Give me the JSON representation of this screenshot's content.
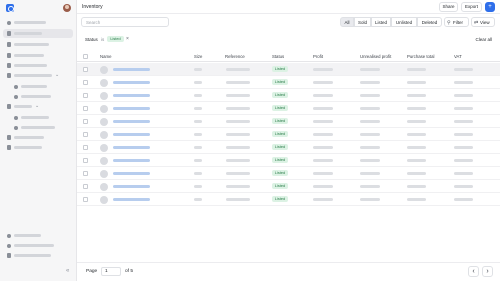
{
  "header": {
    "title": "Inventory",
    "share_label": "Share",
    "export_label": "Export",
    "add_label": "+"
  },
  "search": {
    "placeholder": "Search"
  },
  "status_tabs": [
    "All",
    "Sold",
    "Listed",
    "Unlisted",
    "Deleted"
  ],
  "active_tab": "All",
  "tools": {
    "filter_label": "Filter",
    "view_label": "View"
  },
  "active_filter": {
    "label": "Status",
    "operator": "is",
    "value": "Listed",
    "remove": "×",
    "clear_label": "Clear all"
  },
  "table": {
    "columns": [
      "Name",
      "Size",
      "Reference",
      "Status",
      "Profit",
      "Unrealised profit",
      "Purchase total",
      "VAT"
    ],
    "row_status": "Listed",
    "row_count": 11
  },
  "pagination": {
    "label": "Page",
    "current": "1",
    "of_label": "of 5",
    "prev": "‹",
    "next": "›"
  },
  "sidebar": {
    "collapse_icon": "«"
  },
  "colors": {
    "accent": "#2f6fea",
    "listed_bg": "#dcf2e4",
    "listed_text": "#267a46"
  },
  "icons": [
    "logo-icon",
    "avatar",
    "search-icon",
    "filter-icon",
    "view-icon",
    "chevron-left-icon",
    "chevron-right-icon"
  ]
}
